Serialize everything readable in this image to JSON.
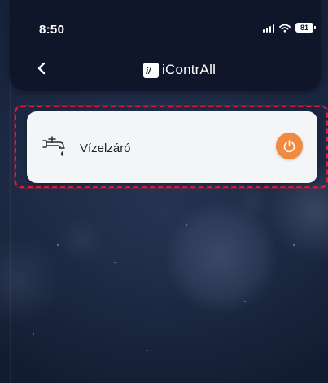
{
  "status_bar": {
    "time": "8:50",
    "battery": "81"
  },
  "header": {
    "back_icon": "chevron-left-icon",
    "brand_logo_text": "i/",
    "brand_name": "iContrAll"
  },
  "devices": [
    {
      "name": "Vízelzáró",
      "icon": "water-valve-icon",
      "power_icon": "power-icon",
      "power_state_color": "#f08a3e"
    }
  ],
  "colors": {
    "header_bg": "#0f1629",
    "card_bg": "#f4f5f7",
    "accent": "#f08a3e",
    "highlight": "#e01b3c"
  }
}
